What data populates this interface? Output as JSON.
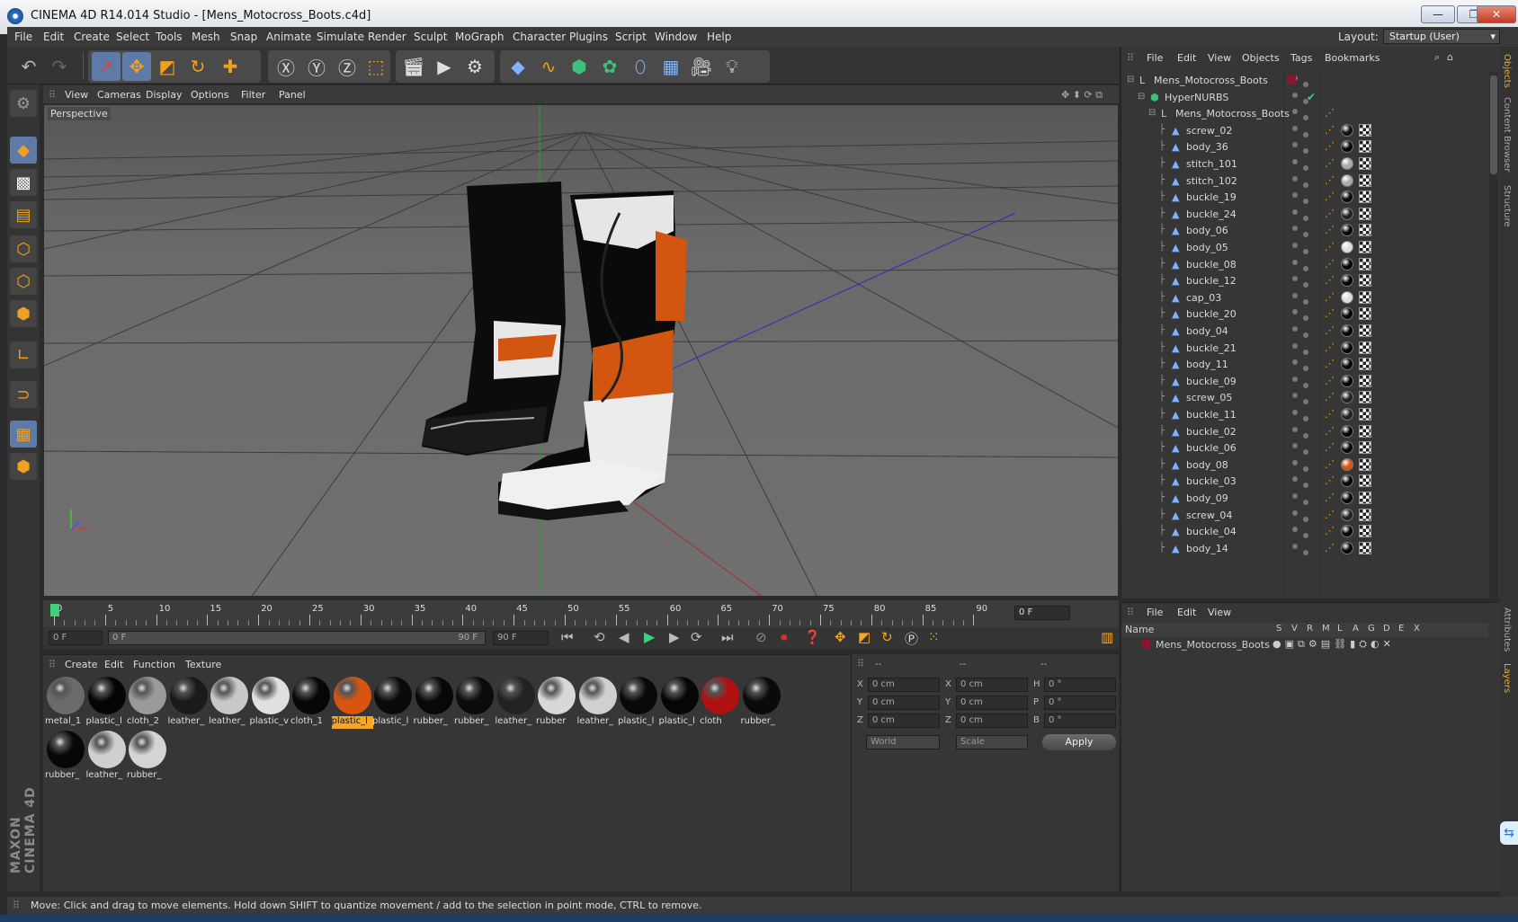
{
  "window": {
    "title": "CINEMA 4D R14.014 Studio - [Mens_Motocross_Boots.c4d]",
    "minimize": "—",
    "restore": "❐",
    "close": "✕"
  },
  "menubar": {
    "items": [
      "File",
      "Edit",
      "Create",
      "Select",
      "Tools",
      "Mesh",
      "Snap",
      "Animate",
      "Simulate",
      "Render",
      "Sculpt",
      "MoGraph",
      "Character",
      "Plugins",
      "Script",
      "Window",
      "Help"
    ],
    "layout_label": "Layout:",
    "layout_value": "Startup (User)"
  },
  "viewport": {
    "menu": [
      "View",
      "Cameras",
      "Display",
      "Options",
      "Filter",
      "Panel"
    ],
    "camera_label": "Perspective"
  },
  "timeline": {
    "ticks": [
      "0",
      "5",
      "10",
      "15",
      "20",
      "25",
      "30",
      "35",
      "40",
      "45",
      "50",
      "55",
      "60",
      "65",
      "70",
      "75",
      "80",
      "85",
      "90"
    ],
    "current_frame": "0 F",
    "start_frame": "0 F",
    "range_start": "0 F",
    "range_end": "90 F",
    "end_frame": "90 F"
  },
  "materials": {
    "menu": [
      "Create",
      "Edit",
      "Function",
      "Texture"
    ],
    "items": [
      {
        "label": "metal_1",
        "color": "#6b6b6b",
        "selected": false
      },
      {
        "label": "plastic_l",
        "color": "#050505",
        "selected": false
      },
      {
        "label": "cloth_2",
        "color": "#9a9a9a",
        "selected": false
      },
      {
        "label": "leather_",
        "color": "#1a1a1a",
        "selected": false
      },
      {
        "label": "leather_",
        "color": "#c8c8c8",
        "selected": false
      },
      {
        "label": "plastic_v",
        "color": "#e0e0e0",
        "selected": false
      },
      {
        "label": "cloth_1",
        "color": "#070707",
        "selected": false
      },
      {
        "label": "plastic_l",
        "color": "#d9540f",
        "selected": true
      },
      {
        "label": "plastic_l",
        "color": "#0a0a0a",
        "selected": false
      },
      {
        "label": "rubber_",
        "color": "#080808",
        "selected": false
      },
      {
        "label": "rubber_",
        "color": "#0b0b0b",
        "selected": false
      },
      {
        "label": "leather_",
        "color": "#222222",
        "selected": false
      },
      {
        "label": "rubber",
        "color": "#d8d8d8",
        "selected": false
      },
      {
        "label": "leather_",
        "color": "#d0d0d0",
        "selected": false
      },
      {
        "label": "plastic_l",
        "color": "#090909",
        "selected": false
      },
      {
        "label": "plastic_l",
        "color": "#060606",
        "selected": false
      },
      {
        "label": "cloth",
        "color": "#b01010",
        "selected": false
      },
      {
        "label": "rubber_",
        "color": "#0a0a0a",
        "selected": false
      },
      {
        "label": "rubber_",
        "color": "#070707",
        "selected": false
      },
      {
        "label": "leather_",
        "color": "#cfcfcf",
        "selected": false
      },
      {
        "label": "rubber_",
        "color": "#d4d4d4",
        "selected": false
      }
    ]
  },
  "coordinates": {
    "header": [
      "--",
      "--",
      "--"
    ],
    "rows": [
      {
        "a": "X",
        "av": "0 cm",
        "b": "X",
        "bv": "0 cm",
        "c": "H",
        "cv": "0 °"
      },
      {
        "a": "Y",
        "av": "0 cm",
        "b": "Y",
        "bv": "0 cm",
        "c": "P",
        "cv": "0 °"
      },
      {
        "a": "Z",
        "av": "0 cm",
        "b": "Z",
        "bv": "0 cm",
        "c": "B",
        "cv": "0 °"
      }
    ],
    "world": "World",
    "scale": "Scale",
    "apply": "Apply"
  },
  "objects_panel": {
    "menu": [
      "File",
      "Edit",
      "View",
      "Objects",
      "Tags",
      "Bookmarks"
    ],
    "tree": [
      {
        "name": "Mens_Motocross_Boots",
        "level": 0,
        "icon": "null-icon"
      },
      {
        "name": "HyperNURBS",
        "level": 1,
        "icon": "hypernurbs-icon"
      },
      {
        "name": "Mens_Motocross_Boots",
        "level": 2,
        "icon": "null-icon"
      },
      {
        "name": "screw_02",
        "level": 3,
        "icon": "polygon-icon",
        "tag": "#111"
      },
      {
        "name": "body_36",
        "level": 3,
        "icon": "polygon-icon",
        "tag": "#050505"
      },
      {
        "name": "stitch_101",
        "level": 3,
        "icon": "polygon-icon",
        "tag": "#aaa"
      },
      {
        "name": "stitch_102",
        "level": 3,
        "icon": "polygon-icon",
        "tag": "#aaa"
      },
      {
        "name": "buckle_19",
        "level": 3,
        "icon": "polygon-icon",
        "tag": "#0a0a0a"
      },
      {
        "name": "buckle_24",
        "level": 3,
        "icon": "polygon-icon",
        "tag": "#222"
      },
      {
        "name": "body_06",
        "level": 3,
        "icon": "polygon-icon",
        "tag": "#0a0a0a"
      },
      {
        "name": "body_05",
        "level": 3,
        "icon": "polygon-icon",
        "tag": "#ddd"
      },
      {
        "name": "buckle_08",
        "level": 3,
        "icon": "polygon-icon",
        "tag": "#050505"
      },
      {
        "name": "buckle_12",
        "level": 3,
        "icon": "polygon-icon",
        "tag": "#050505"
      },
      {
        "name": "cap_03",
        "level": 3,
        "icon": "polygon-icon",
        "tag": "#ddd"
      },
      {
        "name": "buckle_20",
        "level": 3,
        "icon": "polygon-icon",
        "tag": "#050505"
      },
      {
        "name": "body_04",
        "level": 3,
        "icon": "polygon-icon",
        "tag": "#050505"
      },
      {
        "name": "buckle_21",
        "level": 3,
        "icon": "polygon-icon",
        "tag": "#050505"
      },
      {
        "name": "body_11",
        "level": 3,
        "icon": "polygon-icon",
        "tag": "#050505"
      },
      {
        "name": "buckle_09",
        "level": 3,
        "icon": "polygon-icon",
        "tag": "#050505"
      },
      {
        "name": "screw_05",
        "level": 3,
        "icon": "polygon-icon",
        "tag": "#222"
      },
      {
        "name": "buckle_11",
        "level": 3,
        "icon": "polygon-icon",
        "tag": "#222"
      },
      {
        "name": "buckle_02",
        "level": 3,
        "icon": "polygon-icon",
        "tag": "#050505"
      },
      {
        "name": "buckle_06",
        "level": 3,
        "icon": "polygon-icon",
        "tag": "#050505"
      },
      {
        "name": "body_08",
        "level": 3,
        "icon": "polygon-icon",
        "tag": "#d9540f"
      },
      {
        "name": "buckle_03",
        "level": 3,
        "icon": "polygon-icon",
        "tag": "#050505"
      },
      {
        "name": "body_09",
        "level": 3,
        "icon": "polygon-icon",
        "tag": "#050505"
      },
      {
        "name": "screw_04",
        "level": 3,
        "icon": "polygon-icon",
        "tag": "#222"
      },
      {
        "name": "buckle_04",
        "level": 3,
        "icon": "polygon-icon",
        "tag": "#050505"
      },
      {
        "name": "body_14",
        "level": 3,
        "icon": "polygon-icon",
        "tag": "#050505"
      }
    ]
  },
  "layers_panel": {
    "menu": [
      "File",
      "Edit",
      "View"
    ],
    "header": {
      "name": "Name",
      "cols": [
        "S",
        "V",
        "R",
        "M",
        "L",
        "A",
        "G",
        "D",
        "E",
        "X"
      ]
    },
    "row": "Mens_Motocross_Boots"
  },
  "right_tabs": [
    "Objects",
    "Content Browser",
    "Structure",
    "Attributes",
    "Layers"
  ],
  "brand": "MAXON CINEMA 4D",
  "status": "Move: Click and drag to move elements. Hold down SHIFT to quantize movement / add to the selection in point mode, CTRL to remove.",
  "colors": {
    "accent": "#f5a623",
    "selection": "#5e7aa6",
    "background": "#363636"
  }
}
